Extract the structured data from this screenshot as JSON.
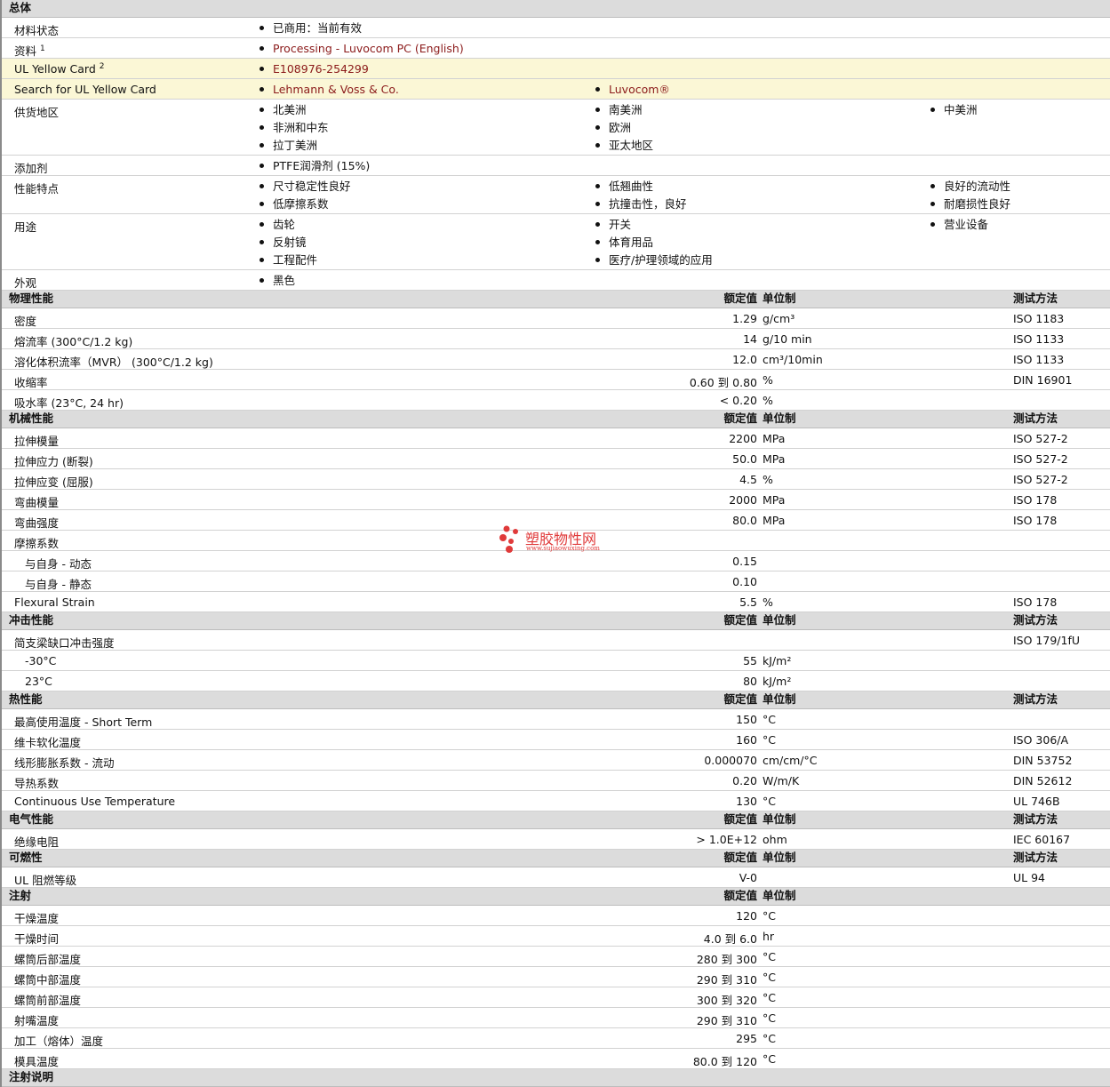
{
  "general": {
    "title": "总体",
    "rows": [
      {
        "label": "材料状态",
        "cols": [
          [
            "已商用：当前有效"
          ]
        ]
      },
      {
        "label": "资料",
        "sup": "1",
        "cols": [
          [
            "Processing - Luvocom PC (English)"
          ]
        ],
        "link": true
      },
      {
        "label": "UL Yellow Card",
        "sup": "2",
        "cols": [
          [
            "E108976-254299"
          ]
        ],
        "link": true,
        "yellow": true
      },
      {
        "label": "Search for UL Yellow Card",
        "cols": [
          [
            "Lehmann & Voss & Co."
          ],
          [
            "Luvocom®"
          ]
        ],
        "link": true,
        "yellow": true
      },
      {
        "label": "供货地区",
        "cols": [
          [
            "北美洲",
            "非洲和中东",
            "拉丁美洲"
          ],
          [
            "南美洲",
            "欧洲",
            "亚太地区"
          ],
          [
            "中美洲"
          ]
        ]
      },
      {
        "label": "添加剂",
        "cols": [
          [
            "PTFE润滑剂 (15%)"
          ]
        ]
      },
      {
        "label": "性能特点",
        "cols": [
          [
            "尺寸稳定性良好",
            "低摩擦系数"
          ],
          [
            "低翘曲性",
            "抗撞击性，良好"
          ],
          [
            "良好的流动性",
            "耐磨损性良好"
          ]
        ]
      },
      {
        "label": "用途",
        "cols": [
          [
            "齿轮",
            "反射镜",
            "工程配件"
          ],
          [
            "开关",
            "体育用品",
            "医疗/护理领域的应用"
          ],
          [
            "营业设备"
          ]
        ]
      },
      {
        "label": "外观",
        "cols": [
          [
            "黑色"
          ]
        ]
      }
    ]
  },
  "headers": {
    "value": "额定值",
    "unit": "单位制",
    "test": "测试方法"
  },
  "sections": [
    {
      "title": "物理性能",
      "test": true,
      "rows": [
        {
          "label": "密度",
          "value": "1.29",
          "unit": "g/cm³",
          "test": "ISO 1183"
        },
        {
          "label": "熔流率 (300°C/1.2 kg)",
          "value": "14",
          "unit": "g/10 min",
          "test": "ISO 1133"
        },
        {
          "label": "溶化体积流率（MVR） (300°C/1.2 kg)",
          "value": "12.0",
          "unit": "cm³/10min",
          "test": "ISO 1133"
        },
        {
          "label": "收缩率",
          "value": "0.60 到  0.80",
          "unit": "%",
          "test": "DIN 16901"
        },
        {
          "label": "吸水率 (23°C, 24 hr)",
          "value": "< 0.20",
          "unit": "%",
          "test": ""
        }
      ]
    },
    {
      "title": "机械性能",
      "test": true,
      "rows": [
        {
          "label": "拉伸模量",
          "value": "2200",
          "unit": "MPa",
          "test": "ISO 527-2"
        },
        {
          "label": "拉伸应力 (断裂)",
          "value": "50.0",
          "unit": "MPa",
          "test": "ISO 527-2"
        },
        {
          "label": "拉伸应变 (屈服)",
          "value": "4.5",
          "unit": "%",
          "test": "ISO 527-2"
        },
        {
          "label": "弯曲模量",
          "value": "2000",
          "unit": "MPa",
          "test": "ISO 178"
        },
        {
          "label": "弯曲强度",
          "value": "80.0",
          "unit": "MPa",
          "test": "ISO 178"
        },
        {
          "label": "摩擦系数",
          "value": "",
          "unit": "",
          "test": ""
        },
        {
          "label": "与自身  - 动态",
          "sub": true,
          "value": "0.15",
          "unit": "",
          "test": ""
        },
        {
          "label": "与自身  - 静态",
          "sub": true,
          "value": "0.10",
          "unit": "",
          "test": ""
        },
        {
          "label": "Flexural Strain",
          "value": "5.5",
          "unit": "%",
          "test": "ISO 178"
        }
      ]
    },
    {
      "title": "冲击性能",
      "test": true,
      "rows": [
        {
          "label": "简支梁缺口冲击强度",
          "value": "",
          "unit": "",
          "test": "ISO 179/1fU"
        },
        {
          "label": "-30°C",
          "sub": true,
          "value": "55",
          "unit": "kJ/m²",
          "test": ""
        },
        {
          "label": "23°C",
          "sub": true,
          "value": "80",
          "unit": "kJ/m²",
          "test": ""
        }
      ]
    },
    {
      "title": "热性能",
      "test": true,
      "rows": [
        {
          "label": "最高使用温度  - Short Term",
          "value": "150",
          "unit": "°C",
          "test": ""
        },
        {
          "label": "维卡软化温度",
          "value": "160",
          "unit": "°C",
          "test": "ISO 306/A"
        },
        {
          "label": "线形膨胀系数  - 流动",
          "value": "0.000070",
          "unit": "cm/cm/°C",
          "test": "DIN 53752"
        },
        {
          "label": "导热系数",
          "value": "0.20",
          "unit": "W/m/K",
          "test": "DIN 52612"
        },
        {
          "label": "Continuous Use Temperature",
          "value": "130",
          "unit": "°C",
          "test": "UL 746B"
        }
      ]
    },
    {
      "title": "电气性能",
      "test": true,
      "rows": [
        {
          "label": "绝缘电阻",
          "value": "> 1.0E+12",
          "unit": "ohm",
          "test": "IEC 60167"
        }
      ]
    },
    {
      "title": "可燃性",
      "test": true,
      "rows": [
        {
          "label": "UL 阻燃等级",
          "value": "V-0",
          "unit": "",
          "test": "UL 94"
        }
      ]
    },
    {
      "title": "注射",
      "test": false,
      "rows": [
        {
          "label": "干燥温度",
          "value": "120",
          "unit": "°C",
          "test": ""
        },
        {
          "label": "干燥时间",
          "value": "4.0 到  6.0",
          "unit": "hr",
          "test": ""
        },
        {
          "label": "螺筒后部温度",
          "value": "280 到  300",
          "unit": "°C",
          "test": ""
        },
        {
          "label": "螺筒中部温度",
          "value": "290 到  310",
          "unit": "°C",
          "test": ""
        },
        {
          "label": "螺筒前部温度",
          "value": "300 到  320",
          "unit": "°C",
          "test": ""
        },
        {
          "label": "射嘴温度",
          "value": "290 到  310",
          "unit": "°C",
          "test": ""
        },
        {
          "label": "加工（熔体）温度",
          "value": "295",
          "unit": "°C",
          "test": ""
        },
        {
          "label": "模具温度",
          "value": "80.0 到  120",
          "unit": "°C",
          "test": ""
        }
      ]
    },
    {
      "title": "注射说明",
      "test": false,
      "header_only": true,
      "rows": []
    }
  ],
  "watermark": {
    "title": "塑胶物性网",
    "url": "www.sujiaowuxing.com",
    "color": "#e03a3a"
  }
}
